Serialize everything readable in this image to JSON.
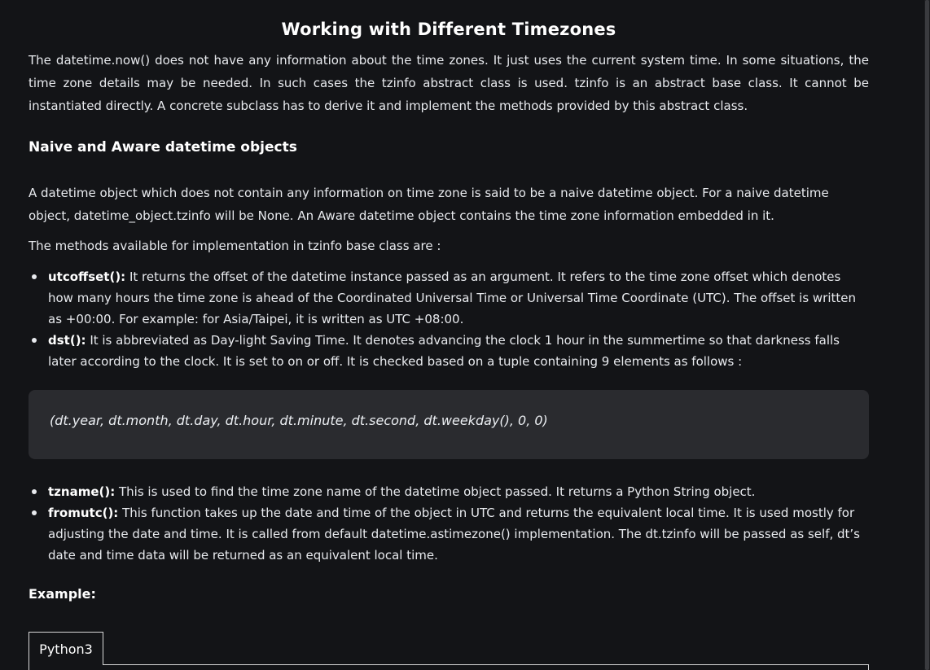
{
  "article": {
    "title": "Working with Different Timezones",
    "intro": "The datetime.now() does not have any information about the time zones. It just uses the current system time. In some situations, the time zone details may be needed. In such cases the tzinfo abstract class is used. tzinfo is an abstract base class. It cannot be instantiated directly. A concrete subclass has to derive it and implement the methods provided by this abstract class.",
    "subheading": "Naive and Aware datetime objects",
    "para1": "A datetime object which does not contain any information on time zone is said to be a naive datetime object. For a naive datetime object, datetime_object.tzinfo will be None. An Aware datetime object contains the time zone information embedded in it.",
    "para2": "The methods available for implementation in tzinfo base class are :",
    "methods_a": [
      {
        "name": "utcoffset():",
        "desc": " It returns the offset of the datetime instance passed as an argument. It refers to the time zone offset which denotes how many hours the time zone is ahead of the Coordinated Universal Time or Universal Time Coordinate (UTC). The offset is written as +00:00. For example: for Asia/Taipei, it is written as UTC +08:00."
      },
      {
        "name": "dst():",
        "desc": " It is abbreviated as Day-light Saving Time. It denotes advancing the clock 1 hour in the summertime so that darkness falls later according to the clock. It is set to on or off. It is checked based on a tuple containing 9 elements as follows :"
      }
    ],
    "code_tuple": "(dt.year, dt.month, dt.day, dt.hour, dt.minute, dt.second, dt.weekday(), 0, 0)",
    "methods_b": [
      {
        "name": "tzname():",
        "desc": " This is used to find the time zone name of the datetime object passed. It returns a Python String object."
      },
      {
        "name": "fromutc():",
        "desc": " This function takes up the date and time of the object in UTC and returns the equivalent local time. It is used mostly for adjusting the date and time. It is called from default datetime.astimezone() implementation. The dt.tzinfo will be passed as self, dt’s date and time data will be returned as an equivalent local time."
      }
    ],
    "example_label": "Example:",
    "code_tab": "Python3"
  }
}
